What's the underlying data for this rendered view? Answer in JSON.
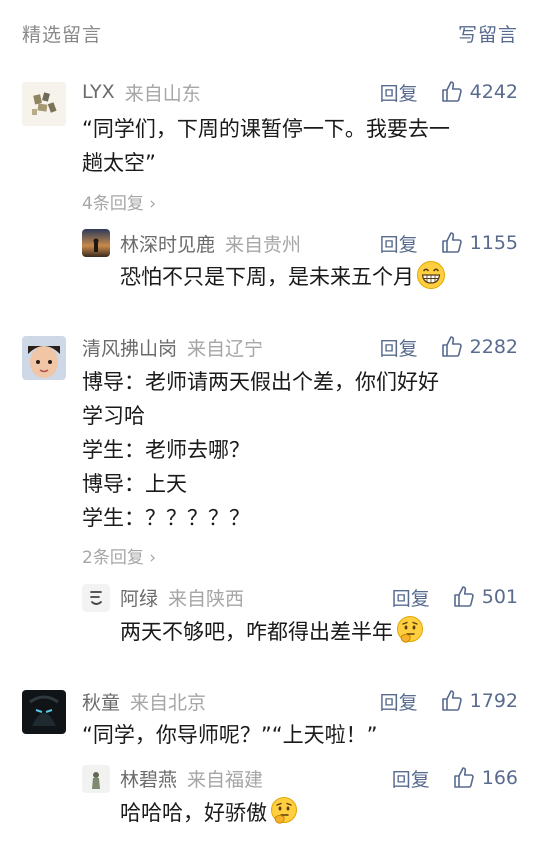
{
  "header": {
    "title": "精选留言",
    "write_label": "写留言"
  },
  "comments": [
    {
      "name": "LYX",
      "location": "来自山东",
      "reply": "回复",
      "likes": "4242",
      "lines": [
        "“同学们，下周的课暂停一下。我要去一",
        "趟太空”"
      ],
      "more": "4条回复",
      "sub": {
        "name": "林深时见鹿",
        "location": "来自贵州",
        "reply": "回复",
        "likes": "1155",
        "text": "恐怕不只是下周，是未来五个月",
        "emoji": "grinning-face-emoji"
      }
    },
    {
      "name": "清风拂山岗",
      "location": "来自辽宁",
      "reply": "回复",
      "likes": "2282",
      "lines": [
        "博导：老师请两天假出个差，你们好好",
        "学习哈",
        "学生：老师去哪？",
        "博导：上天",
        "学生：？？？？？"
      ],
      "more": "2条回复",
      "sub": {
        "name": "阿绿",
        "location": "来自陕西",
        "reply": "回复",
        "likes": "501",
        "text": "两天不够吧，咋都得出差半年",
        "emoji": "thinking-face-emoji"
      }
    },
    {
      "name": "秋童",
      "location": "来自北京",
      "reply": "回复",
      "likes": "1792",
      "lines": [
        "“同学，你导师呢？”“上天啦！”"
      ],
      "sub": {
        "name": "林碧燕",
        "location": "来自福建",
        "reply": "回复",
        "likes": "166",
        "text": "哈哈哈，好骄傲",
        "emoji": "thinking-face-emoji"
      }
    }
  ],
  "colors": {
    "link_blue": "#586b8f",
    "name_gray": "#6b6b6b",
    "meta_gray": "#a6a6a6"
  }
}
